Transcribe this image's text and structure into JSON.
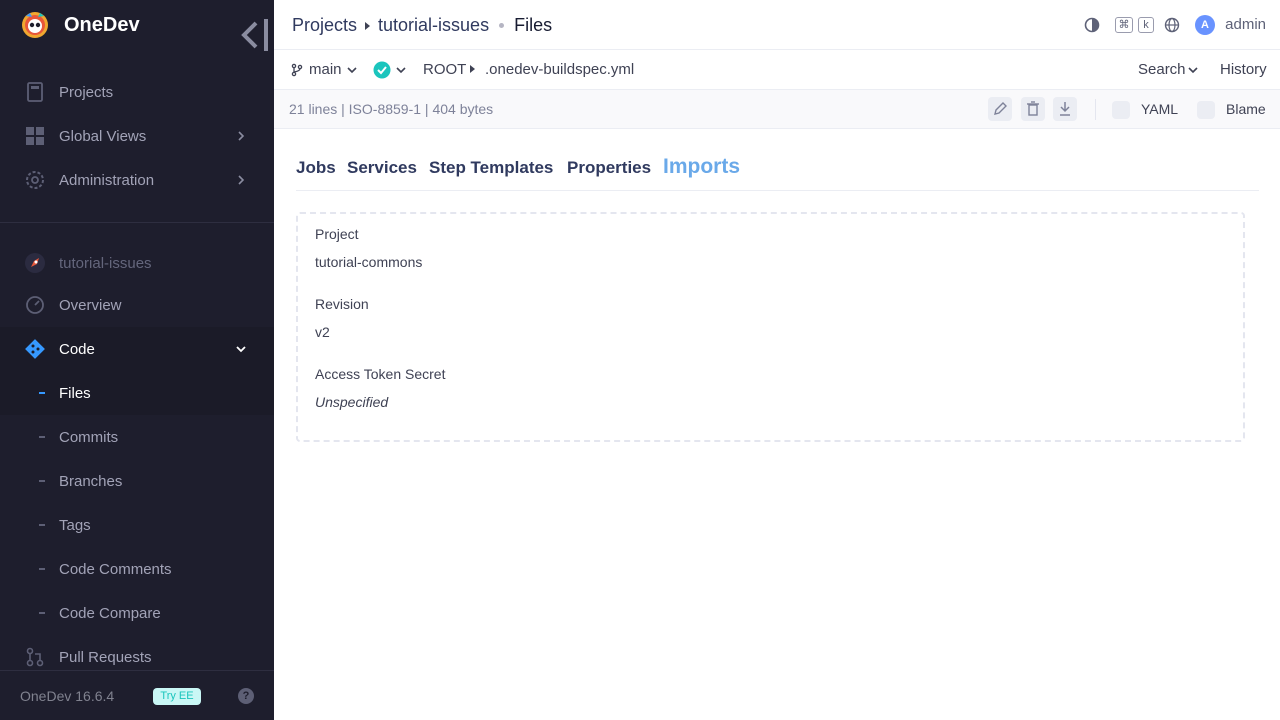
{
  "sidebar": {
    "brand": "OneDev",
    "items": [
      {
        "label": "Projects",
        "icon": "projects-icon"
      },
      {
        "label": "Global Views",
        "icon": "grid-icon"
      },
      {
        "label": "Administration",
        "icon": "gear-icon"
      }
    ],
    "project": "tutorial-issues",
    "project_items": [
      {
        "label": "Overview",
        "icon": "dashboard-icon"
      },
      {
        "label": "Code",
        "icon": "git-icon"
      },
      {
        "label": "Files"
      },
      {
        "label": "Commits"
      },
      {
        "label": "Branches"
      },
      {
        "label": "Tags"
      },
      {
        "label": "Code Comments"
      },
      {
        "label": "Code Compare"
      },
      {
        "label": "Pull Requests",
        "icon": "pull-request-icon"
      }
    ],
    "version": "OneDev 16.6.4",
    "try_ee": "Try EE"
  },
  "header": {
    "crumbs": [
      "Projects",
      "tutorial-issues"
    ],
    "current": "Files",
    "kbd_cmd": "⌘",
    "kbd_k": "k",
    "avatar_letter": "A",
    "user": "admin"
  },
  "revbar": {
    "branch": "main",
    "root": "ROOT",
    "file": ".onedev-buildspec.yml",
    "search": "Search",
    "history": "History"
  },
  "fileinfo": {
    "summary": "21 lines | ISO-8859-1 | 404 bytes",
    "yaml": "YAML",
    "blame": "Blame"
  },
  "tabs": [
    "Jobs",
    "Services",
    "Step Templates",
    "Properties",
    "Imports"
  ],
  "import": {
    "project_label": "Project",
    "project_value": "tutorial-commons",
    "revision_label": "Revision",
    "revision_value": "v2",
    "token_label": "Access Token Secret",
    "token_value": "Unspecified"
  },
  "colors": {
    "sidebar_bg": "#1e1e2d",
    "accent": "#3699ff",
    "active_tab": "#6aa9e9",
    "build_success": "#1bc5bd"
  }
}
